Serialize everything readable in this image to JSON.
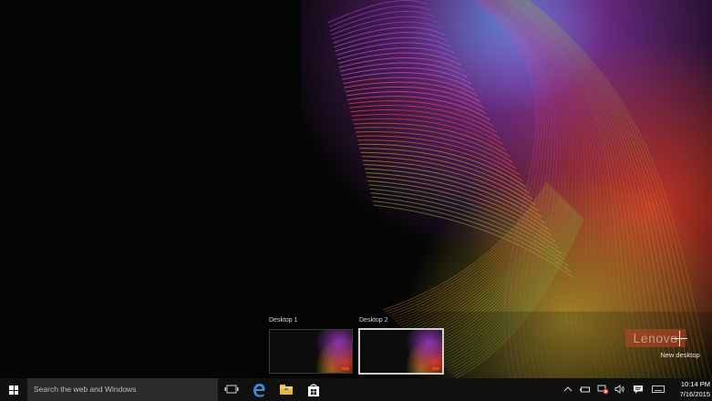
{
  "desktops": [
    {
      "label": "Desktop 1",
      "active": false
    },
    {
      "label": "Desktop 2",
      "active": true
    }
  ],
  "new_desktop": {
    "label": "New desktop",
    "icon": "plus-icon"
  },
  "wallpaper": {
    "logo_text": "Lenovo"
  },
  "taskbar": {
    "start_icon": "windows-logo-icon",
    "search_placeholder": "Search the web and Windows",
    "pinned": [
      {
        "name": "task-view-icon"
      },
      {
        "name": "edge-icon"
      },
      {
        "name": "file-explorer-icon"
      },
      {
        "name": "store-icon"
      }
    ],
    "tray": [
      {
        "name": "chevron-up-icon"
      },
      {
        "name": "battery-icon"
      },
      {
        "name": "network-icon"
      },
      {
        "name": "volume-icon"
      },
      {
        "name": "action-center-icon"
      },
      {
        "name": "keyboard-icon"
      }
    ],
    "clock": {
      "time": "10:14 PM",
      "date": "7/16/2015"
    }
  },
  "colors": {
    "taskbar": "#101010",
    "search_box": "#2b2b2b",
    "accent_edge": "#3c8de0"
  }
}
